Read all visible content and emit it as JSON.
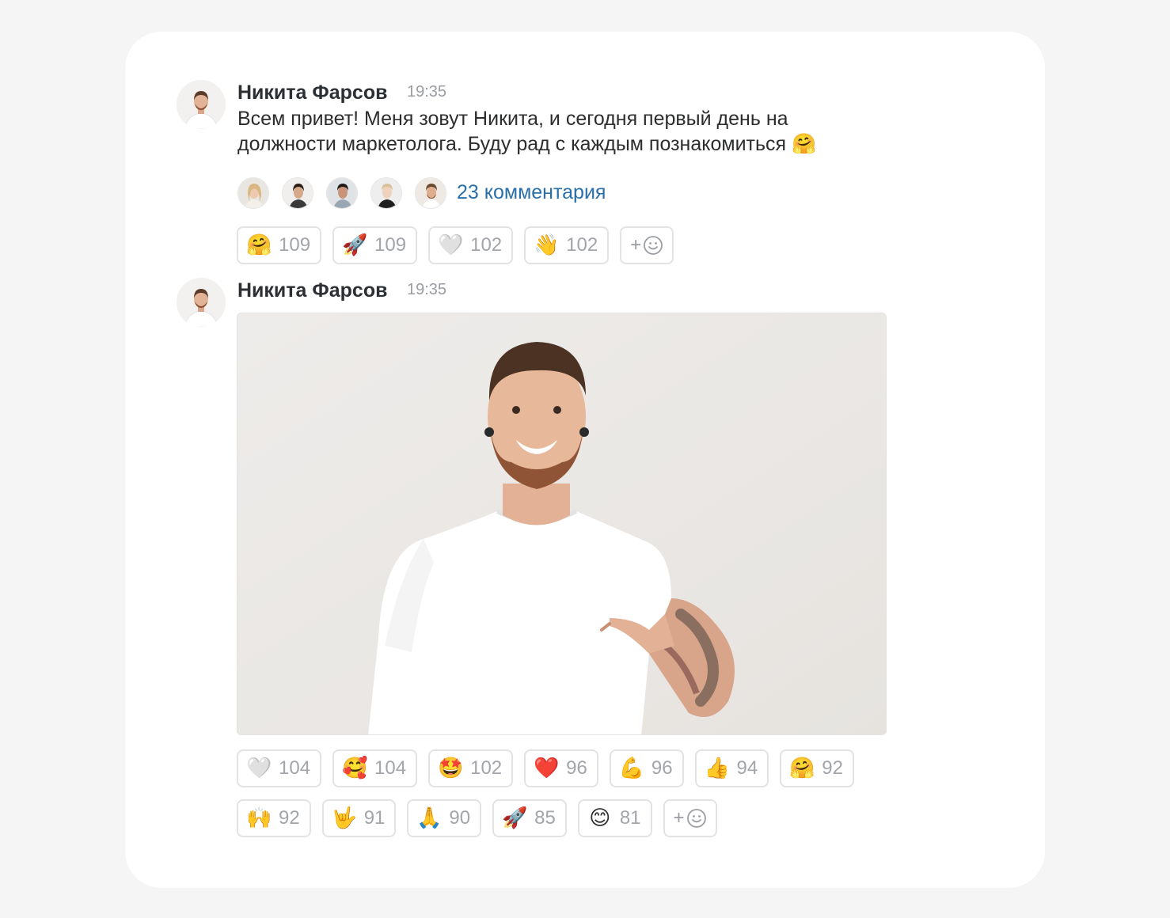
{
  "messages": [
    {
      "author": "Никита Фарсов",
      "time": "19:35",
      "text": "Всем привет! Меня зовут Никита, и сегодня первый день на должности маркетолога. Буду рад с каждым познакомиться 🤗",
      "comments": "23 комментария",
      "reactions": [
        {
          "emoji": "🤗",
          "count": "109"
        },
        {
          "emoji": "🚀",
          "count": "109"
        },
        {
          "emoji": "🤍",
          "count": "102"
        },
        {
          "emoji": "👋",
          "count": "102"
        }
      ]
    },
    {
      "author": "Никита Фарсов",
      "time": "19:35",
      "reactions_row1": [
        {
          "emoji": "🤍",
          "count": "104"
        },
        {
          "emoji": "🥰",
          "count": "104"
        },
        {
          "emoji": "🤩",
          "count": "102"
        },
        {
          "emoji": "❤️",
          "count": "96"
        },
        {
          "emoji": "💪",
          "count": "96"
        },
        {
          "emoji": "👍",
          "count": "94"
        },
        {
          "emoji": "🤗",
          "count": "92"
        }
      ],
      "reactions_row2": [
        {
          "emoji": "🙌",
          "count": "92"
        },
        {
          "emoji": "🤟",
          "count": "91"
        },
        {
          "emoji": "🙏",
          "count": "90"
        },
        {
          "emoji": "🚀",
          "count": "85"
        },
        {
          "emoji": "😊",
          "count": "81"
        }
      ]
    }
  ],
  "add_reaction_label": "+",
  "icons": {
    "add_reaction": "smiley-plus-icon",
    "accent_link_color": "#2a6fa8"
  }
}
